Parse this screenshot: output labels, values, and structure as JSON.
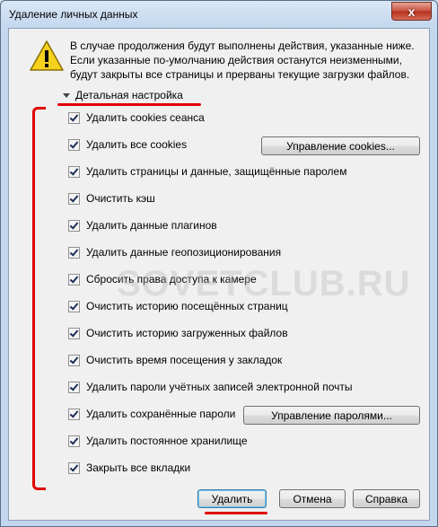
{
  "window": {
    "title": "Удаление личных данных",
    "close_glyph": "x"
  },
  "warning": {
    "lines": [
      "В случае продолжения будут выполнены действия, указанные ниже.",
      "Если указанные по-умолчанию действия останутся неизменными,",
      "будут закрыты все страницы и прерваны текущие загрузки файлов."
    ]
  },
  "details_toggle": "Детальная настройка",
  "options": [
    {
      "label": "Удалить cookies сеанса",
      "checked": true
    },
    {
      "label": "Удалить все cookies",
      "checked": true
    },
    {
      "label": "Удалить страницы и данные, защищённые паролем",
      "checked": true
    },
    {
      "label": "Очистить кэш",
      "checked": true
    },
    {
      "label": "Удалить данные плагинов",
      "checked": true
    },
    {
      "label": "Удалить данные геопозиционирования",
      "checked": true
    },
    {
      "label": "Сбросить права доступа к камере",
      "checked": true
    },
    {
      "label": "Очистить историю посещённых страниц",
      "checked": true
    },
    {
      "label": "Очистить историю загруженных файлов",
      "checked": true
    },
    {
      "label": "Очистить время посещения у закладок",
      "checked": true
    },
    {
      "label": "Удалить пароли учётных записей электронной почты",
      "checked": true
    },
    {
      "label": "Удалить сохранённые пароли",
      "checked": true
    },
    {
      "label": "Удалить постоянное хранилище",
      "checked": true
    },
    {
      "label": "Закрыть все вкладки",
      "checked": true
    }
  ],
  "side_buttons": {
    "manage_cookies": "Управление cookies...",
    "manage_passwords": "Управление паролями..."
  },
  "footer": {
    "delete": "Удалить",
    "cancel": "Отмена",
    "help": "Справка"
  },
  "watermark": "SOVETCLUB.RU",
  "colors": {
    "annotation_red": "#e00000",
    "titlebar": "#c3d7ee",
    "client_bg": "#f0f0f0"
  }
}
